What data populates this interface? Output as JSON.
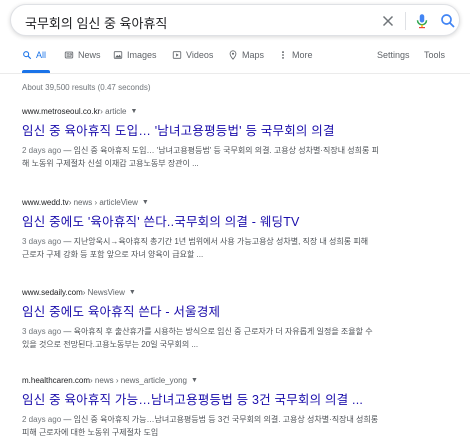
{
  "search": {
    "query": "국무회의 임신 중 육아휴직"
  },
  "tabs": [
    {
      "label": "All",
      "icon": "search-icon",
      "active": true
    },
    {
      "label": "News",
      "icon": "news-icon"
    },
    {
      "label": "Images",
      "icon": "image-icon"
    },
    {
      "label": "Videos",
      "icon": "video-icon"
    },
    {
      "label": "Maps",
      "icon": "map-pin-icon"
    },
    {
      "label": "More",
      "icon": "more-vertical-icon"
    },
    {
      "label": "Settings"
    },
    {
      "label": "Tools"
    }
  ],
  "results_stats": "About 39,500 results (0.47 seconds)",
  "results": [
    {
      "domain": "www.metroseoul.co.kr",
      "path": " › article",
      "title": "임신 중 육아휴직 도입… '남녀고용평등법' 등 국무회의 의결",
      "date": "2 days ago",
      "snippet_1": " — 임신 중 육아휴직 도입… '남녀고용평등법' 등 국무회의 의결. 고용상 성차별·직장내 성희롱 피",
      "snippet_2": "해 노동위 구제절차 신설 이재갑 고용노동부 장관이 ..."
    },
    {
      "domain": "www.wedd.tv",
      "path": " › news › articleView",
      "title": "임신 중에도 '육아휴직' 쓴다..국무회의 의결 - 웨딩TV",
      "date": "3 days ago",
      "snippet_1": " — 지난앙욱시→육아휴직 총기간 1년 범위에서 사용 가능고용상 성차별, 직장 내 성희롱 피해",
      "snippet_2": "근로자 구제 강화 등 포함 앞으로 자녀 양육이 급요할 ..."
    },
    {
      "domain": "www.sedaily.com",
      "path": " › NewsView",
      "title": "임신 중에도 육아휴직 쓴다 - 서울경제",
      "date": "3 days ago",
      "snippet_1": " — 육아휴직 후 출산휴가를 시용하는 방식으로 임신 중 근로자가 더 자유롭게 일정을 조율할 수",
      "snippet_2": "있을 것으로 전망된다.고용노동부는 20일 국무회의 ..."
    },
    {
      "domain": "m.healthcaren.com",
      "path": " › news › news_article_yong",
      "title": "임신 중 육아휴직 가능…남녀고용평등법 등 3건 국무회의 의결 ...",
      "date": "2 days ago",
      "snippet_1": " — 임신 중 육아휴직 가능…남녀고용평등법 등 3건 국무회의 의결. 고용상 성차별·직장내 성희롱",
      "snippet_2": "피해 근로자에 대한 노동위 구제절차 도입"
    }
  ]
}
